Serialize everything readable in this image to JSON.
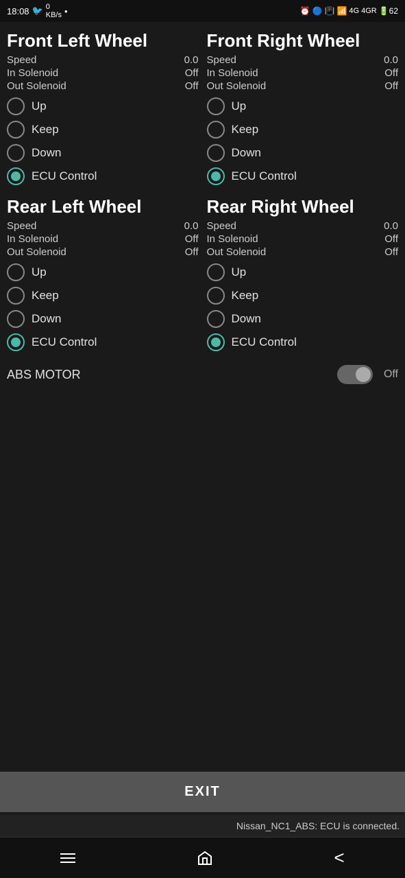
{
  "statusBar": {
    "time": "18:08",
    "rightIcons": "⏰ 🔵 📶 📶 4G 4GR 62"
  },
  "wheels": [
    {
      "id": "front-left",
      "title": "Front Left Wheel",
      "speed": "0.0",
      "inSolenoid": "Off",
      "outSolenoid": "Off",
      "options": [
        "Up",
        "Keep",
        "Down",
        "ECU Control"
      ],
      "selected": "ECU Control"
    },
    {
      "id": "front-right",
      "title": "Front Right Wheel",
      "speed": "0.0",
      "inSolenoid": "Off",
      "outSolenoid": "Off",
      "options": [
        "Up",
        "Keep",
        "Down",
        "ECU Control"
      ],
      "selected": "ECU Control"
    },
    {
      "id": "rear-left",
      "title": "Rear Left Wheel",
      "speed": "0.0",
      "inSolenoid": "Off",
      "outSolenoid": "Off",
      "options": [
        "Up",
        "Keep",
        "Down",
        "ECU Control"
      ],
      "selected": "ECU Control"
    },
    {
      "id": "rear-right",
      "title": "Rear Right Wheel",
      "speed": "0.0",
      "inSolenoid": "Off",
      "outSolenoid": "Off",
      "options": [
        "Up",
        "Keep",
        "Down",
        "ECU Control"
      ],
      "selected": "ECU Control"
    }
  ],
  "absMotor": {
    "label": "ABS MOTOR",
    "value": "Off",
    "enabled": false
  },
  "exitButton": {
    "label": "EXIT"
  },
  "statusMessage": "Nissan_NC1_ABS: ECU is connected.",
  "labels": {
    "speed": "Speed",
    "inSolenoid": "In Solenoid",
    "outSolenoid": "Out Solenoid"
  }
}
